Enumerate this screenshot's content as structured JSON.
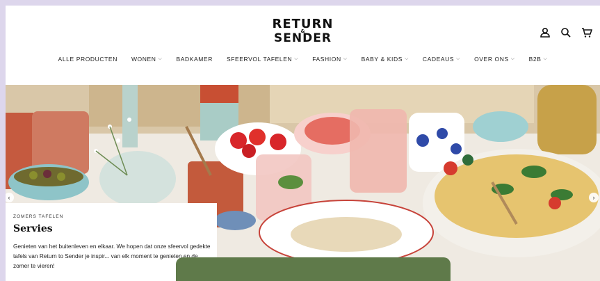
{
  "brand": {
    "line1": "RETURN",
    "amp": "&",
    "line2": "SENDER"
  },
  "header_icons": [
    "account-icon",
    "search-icon",
    "cart-icon"
  ],
  "nav": {
    "items": [
      {
        "label": "ALLE PRODUCTEN",
        "dropdown": false
      },
      {
        "label": "WONEN",
        "dropdown": true
      },
      {
        "label": "BADKAMER",
        "dropdown": false
      },
      {
        "label": "SFEERVOL TAFELEN",
        "dropdown": true
      },
      {
        "label": "FASHION",
        "dropdown": true
      },
      {
        "label": "BABY & KIDS",
        "dropdown": true
      },
      {
        "label": "CADEAUS",
        "dropdown": true
      },
      {
        "label": "OVER ONS",
        "dropdown": true
      },
      {
        "label": "B2B",
        "dropdown": true
      }
    ]
  },
  "hero": {
    "kicker": "ZOMERS TAFELEN",
    "title": "Servies",
    "description": "Genieten van het buitenleven en elkaar. We hopen dat onze sfeervol gedekte tafels van Return to Sender je inspir... van elk moment te genieten en de zomer te vieren!"
  },
  "colors": {
    "accent_green": "#5f7a4a",
    "background": "#ddd6ec"
  }
}
